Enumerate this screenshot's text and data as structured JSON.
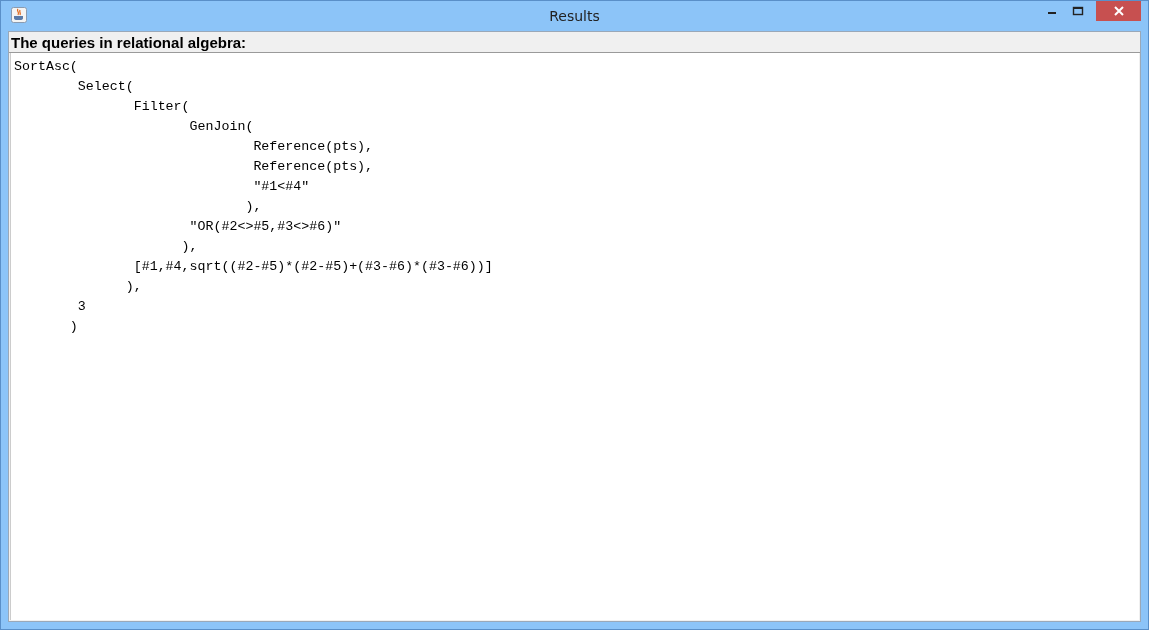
{
  "window": {
    "title": "Results"
  },
  "panel": {
    "heading": "The queries in relational algebra:",
    "code_lines": [
      "SortAsc(",
      "        Select(",
      "               Filter(",
      "                      GenJoin(",
      "                              Reference(pts),",
      "                              Reference(pts),",
      "                              \"#1<#4\"",
      "                             ),",
      "                      \"OR(#2<>#5,#3<>#6)\"",
      "                     ),",
      "               [#1,#4,sqrt((#2-#5)*(#2-#5)+(#3-#6)*(#3-#6))]",
      "              ),",
      "        3",
      "       )"
    ]
  }
}
